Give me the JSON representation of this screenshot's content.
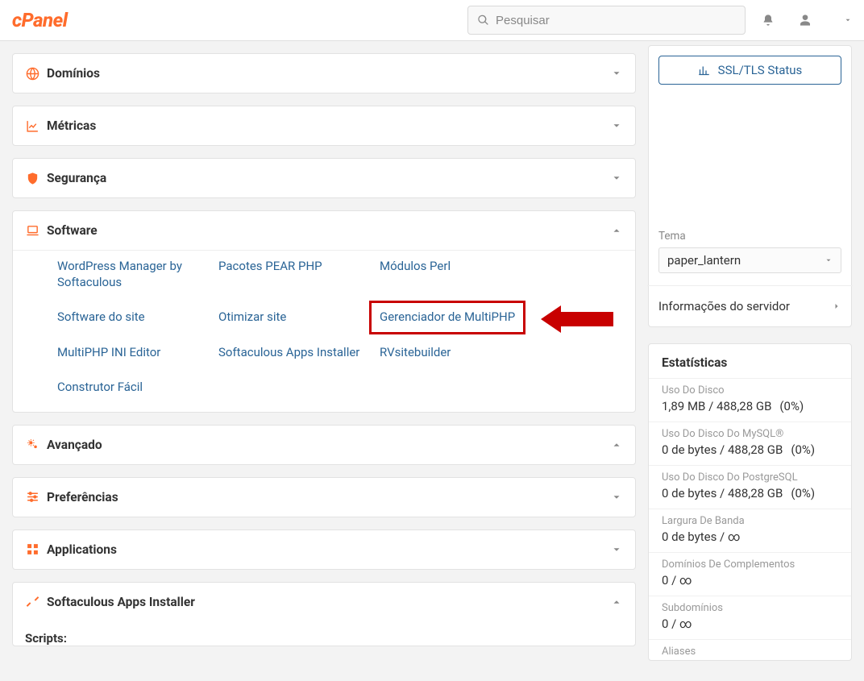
{
  "brand": "cPanel",
  "search": {
    "placeholder": "Pesquisar"
  },
  "panels": {
    "dominios": {
      "title": "Domínios"
    },
    "metricas": {
      "title": "Métricas"
    },
    "seguranca": {
      "title": "Segurança"
    },
    "software": {
      "title": "Software",
      "items": [
        "WordPress Manager by Softaculous",
        "Pacotes PEAR PHP",
        "Módulos Perl",
        "Software do site",
        "Otimizar site",
        "Gerenciador de MultiPHP",
        "MultiPHP INI Editor",
        "Softaculous Apps Installer",
        "RVsitebuilder",
        "Construtor Fácil"
      ]
    },
    "avancado": {
      "title": "Avançado"
    },
    "preferencias": {
      "title": "Preferências"
    },
    "applications": {
      "title": "Applications"
    },
    "softaculous": {
      "title": "Softaculous Apps Installer",
      "scripts_label": "Scripts:"
    }
  },
  "sidebar": {
    "ssl_button": "SSL/TLS Status",
    "tema_label": "Tema",
    "tema_value": "paper_lantern",
    "server_info": "Informações do servidor",
    "stats_title": "Estatísticas",
    "stats": [
      {
        "label": "Uso Do Disco",
        "value": "1,89 MB / 488,28 GB",
        "pct": "(0%)"
      },
      {
        "label": "Uso Do Disco Do MySQL®",
        "value": "0 de bytes / 488,28 GB",
        "pct": "(0%)"
      },
      {
        "label": "Uso Do Disco Do PostgreSQL",
        "value": "0 de bytes / 488,28 GB",
        "pct": "(0%)"
      },
      {
        "label": "Largura De Banda",
        "value": "0 de bytes / ∞",
        "pct": ""
      },
      {
        "label": "Domínios De Complementos",
        "value": "0 / ∞",
        "pct": ""
      },
      {
        "label": "Subdomínios",
        "value": "0 / ∞",
        "pct": ""
      },
      {
        "label": "Aliases",
        "value": "",
        "pct": ""
      }
    ]
  },
  "colors": {
    "brand": "#ff6c2c",
    "link": "#2a6496",
    "callout": "#c80000"
  }
}
